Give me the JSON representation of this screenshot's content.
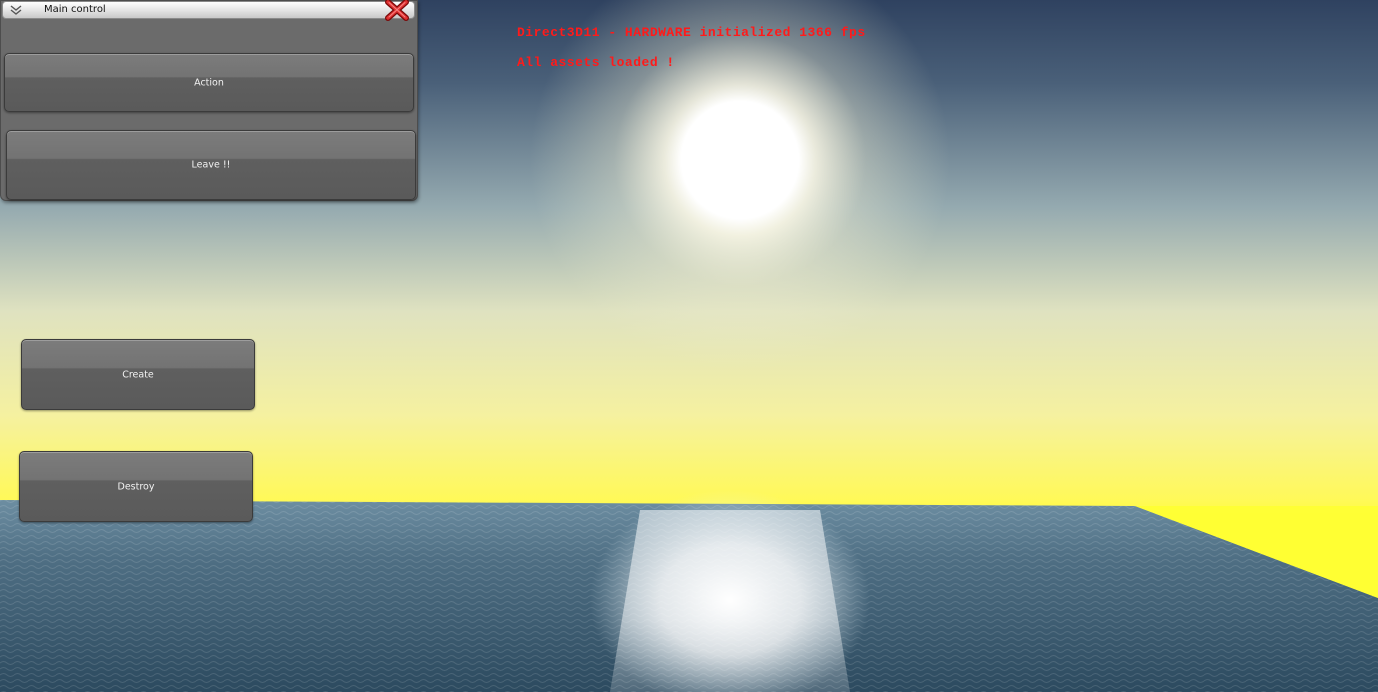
{
  "overlay": {
    "status_line": "Direct3D11 - HARDWARE initialized 1366 fps",
    "assets_line": "All assets loaded !"
  },
  "window": {
    "title": "Main control",
    "collapse_icon": "chevron-down-icon",
    "close_icon": "close-x-icon",
    "buttons": {
      "action": "Action",
      "leave": "Leave !!"
    }
  },
  "buttons": {
    "create": "Create",
    "destroy": "Destroy"
  },
  "colors": {
    "overlay_text": "#ff1a1a",
    "panel": "#6b6b6b",
    "button_text": "#f2f2f2",
    "close_icon": "#d42020"
  }
}
